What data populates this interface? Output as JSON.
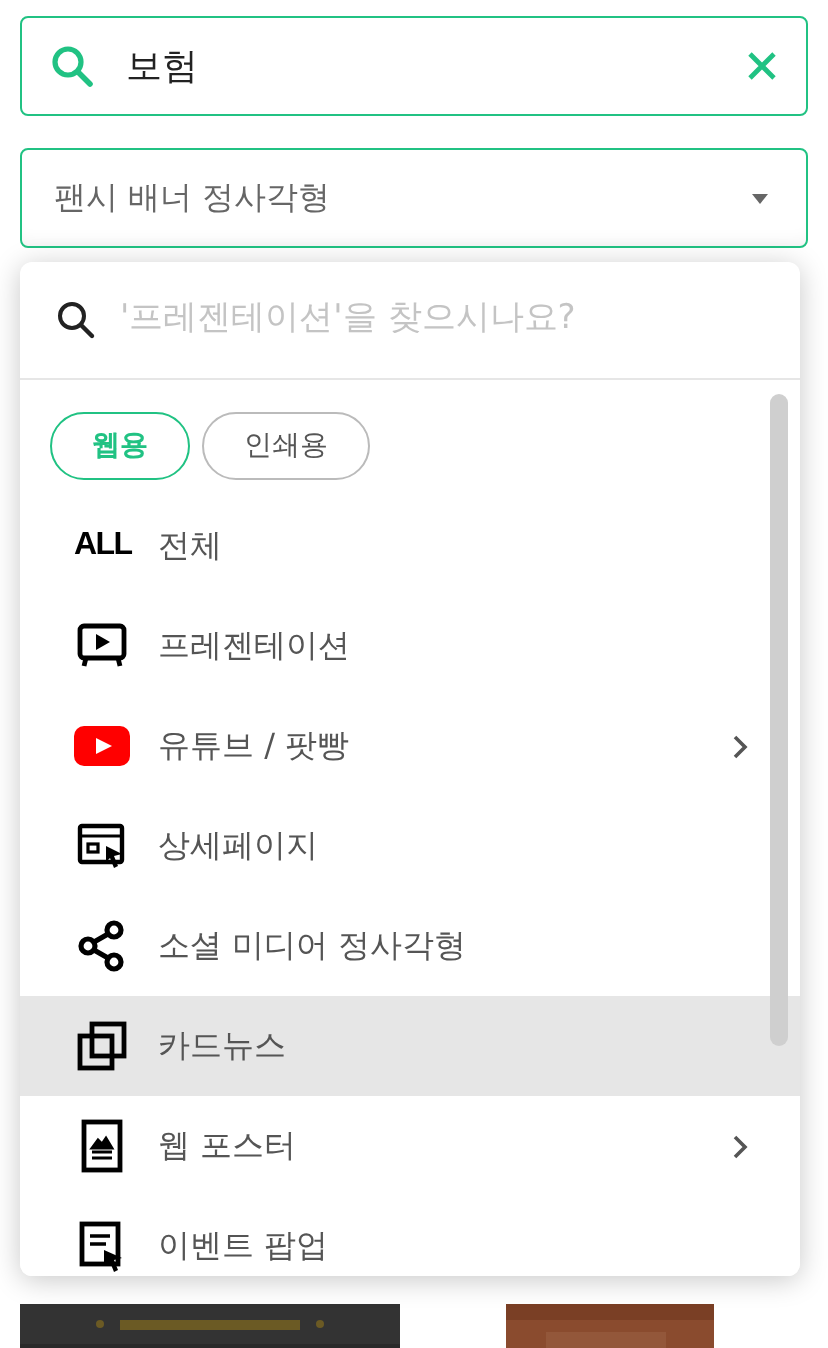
{
  "search": {
    "value": "보험"
  },
  "dropdown": {
    "value": "팬시 배너 정사각형"
  },
  "panel": {
    "search": {
      "placeholder": "'프레젠테이션'을 찾으시나요?"
    },
    "chips": [
      {
        "label": "웹용",
        "selected": true
      },
      {
        "label": "인쇄용",
        "selected": false
      }
    ],
    "items": [
      {
        "kind": "all",
        "icon_label": "ALL",
        "label": "전체",
        "highlighted": false,
        "has_submenu": false
      },
      {
        "kind": "presentation",
        "label": "프레젠테이션",
        "highlighted": false,
        "has_submenu": false
      },
      {
        "kind": "youtube",
        "label": "유튜브 / 팟빵",
        "highlighted": false,
        "has_submenu": true
      },
      {
        "kind": "detail",
        "label": "상세페이지",
        "highlighted": false,
        "has_submenu": false
      },
      {
        "kind": "social",
        "label": "소셜 미디어 정사각형",
        "highlighted": false,
        "has_submenu": false
      },
      {
        "kind": "cards",
        "label": "카드뉴스",
        "highlighted": true,
        "has_submenu": false
      },
      {
        "kind": "poster",
        "label": "웹 포스터",
        "highlighted": false,
        "has_submenu": true
      },
      {
        "kind": "popup",
        "label": "이벤트 팝업",
        "highlighted": false,
        "has_submenu": false
      }
    ]
  }
}
